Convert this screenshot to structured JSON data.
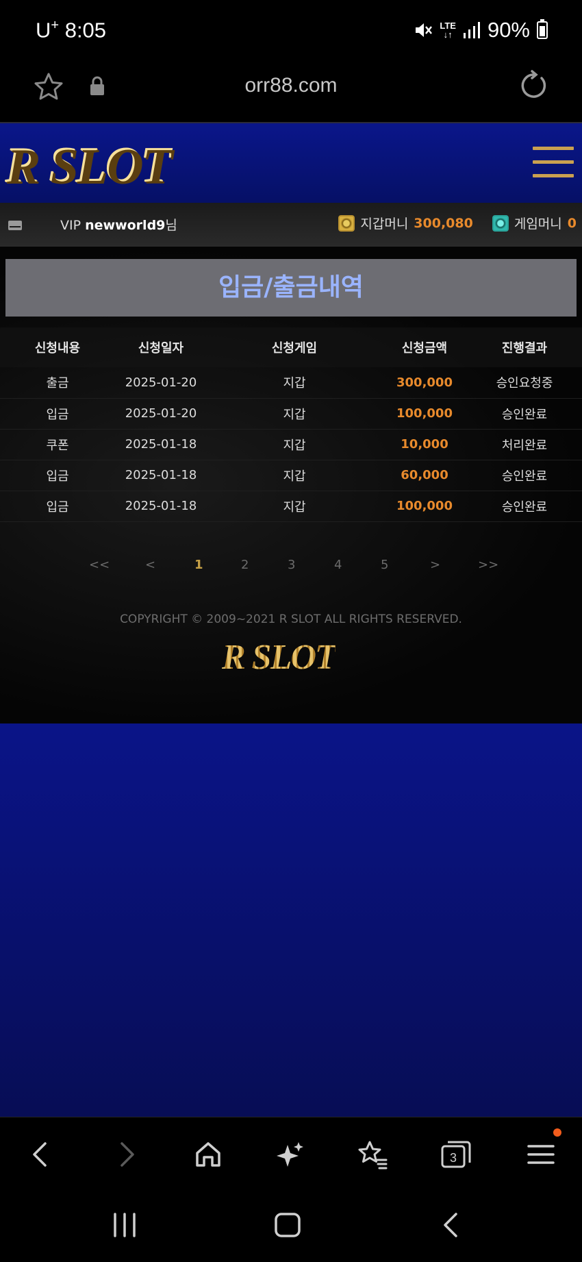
{
  "status_bar": {
    "carrier": "U",
    "carrier_sup": "+",
    "time": "8:05",
    "network": "LTE",
    "battery": "90%"
  },
  "browser": {
    "url": "orr88.com",
    "tab_count": "3"
  },
  "site": {
    "logo_text": "R SLOT",
    "user_prefix": "VIP ",
    "username": "newworld9",
    "user_suffix": "님",
    "wallet_label": "지갑머니",
    "wallet_value": "300,080",
    "game_label": "게임머니",
    "game_value": "0"
  },
  "page": {
    "title": "입금/출금내역",
    "columns": [
      "신청내용",
      "신청일자",
      "신청게임",
      "신청금액",
      "진행결과"
    ],
    "rows": [
      {
        "type": "출금",
        "date": "2025-01-20",
        "game": "지갑",
        "amount": "300,000",
        "status": "승인요청중"
      },
      {
        "type": "입금",
        "date": "2025-01-20",
        "game": "지갑",
        "amount": "100,000",
        "status": "승인완료"
      },
      {
        "type": "쿠폰",
        "date": "2025-01-18",
        "game": "지갑",
        "amount": "10,000",
        "status": "처리완료"
      },
      {
        "type": "입금",
        "date": "2025-01-18",
        "game": "지갑",
        "amount": "60,000",
        "status": "승인완료"
      },
      {
        "type": "입금",
        "date": "2025-01-18",
        "game": "지갑",
        "amount": "100,000",
        "status": "승인완료"
      }
    ],
    "pagination": {
      "first": "<<",
      "prev": "<",
      "pages": [
        "1",
        "2",
        "3",
        "4",
        "5"
      ],
      "current": "1",
      "next": ">",
      "last": ">>"
    },
    "copyright": "COPYRIGHT © 2009~2021 R SLOT ALL RIGHTS RESERVED.",
    "footer_logo": "R SLOT"
  },
  "colors": {
    "accent_gold": "#c9a050",
    "amount_orange": "#e88a2c",
    "header_blue": "#0a168a",
    "title_text": "#9ab4ff"
  },
  "icons": [
    "star-icon",
    "lock-icon",
    "reload-icon",
    "menu-icon",
    "mail-icon",
    "wallet-icon",
    "game-money-icon",
    "back-icon",
    "forward-icon",
    "home-icon",
    "sparkle-icon",
    "bookmarks-icon",
    "tabs-icon",
    "browser-menu-icon",
    "recents-icon",
    "home-square-icon",
    "system-back-icon"
  ]
}
